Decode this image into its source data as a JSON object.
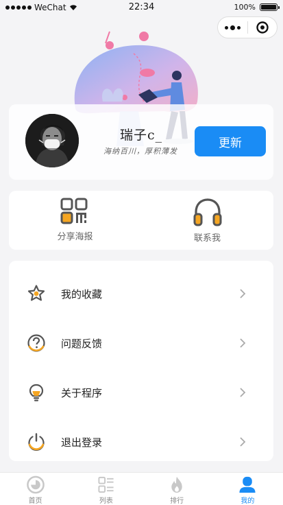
{
  "status_bar": {
    "carrier": "WeChat",
    "time": "22:34",
    "battery": "100%"
  },
  "profile": {
    "username": "瑞子c_",
    "motto": "海纳百川，厚积薄发",
    "update_label": "更新"
  },
  "actions": [
    {
      "label": "分享海报",
      "icon": "qrcode-icon"
    },
    {
      "label": "联系我",
      "icon": "headphones-icon"
    }
  ],
  "menu": [
    {
      "label": "我的收藏",
      "icon": "star-icon"
    },
    {
      "label": "问题反馈",
      "icon": "question-icon"
    },
    {
      "label": "关于程序",
      "icon": "lightbulb-icon"
    },
    {
      "label": "退出登录",
      "icon": "power-icon"
    }
  ],
  "tabs": [
    {
      "label": "首页",
      "icon": "home-icon",
      "active": false
    },
    {
      "label": "列表",
      "icon": "list-icon",
      "active": false
    },
    {
      "label": "排行",
      "icon": "flame-icon",
      "active": false
    },
    {
      "label": "我的",
      "icon": "user-icon",
      "active": true
    }
  ],
  "colors": {
    "accent": "#1a8cf5",
    "icon_orange": "#f5a623",
    "icon_gray": "#555555"
  }
}
